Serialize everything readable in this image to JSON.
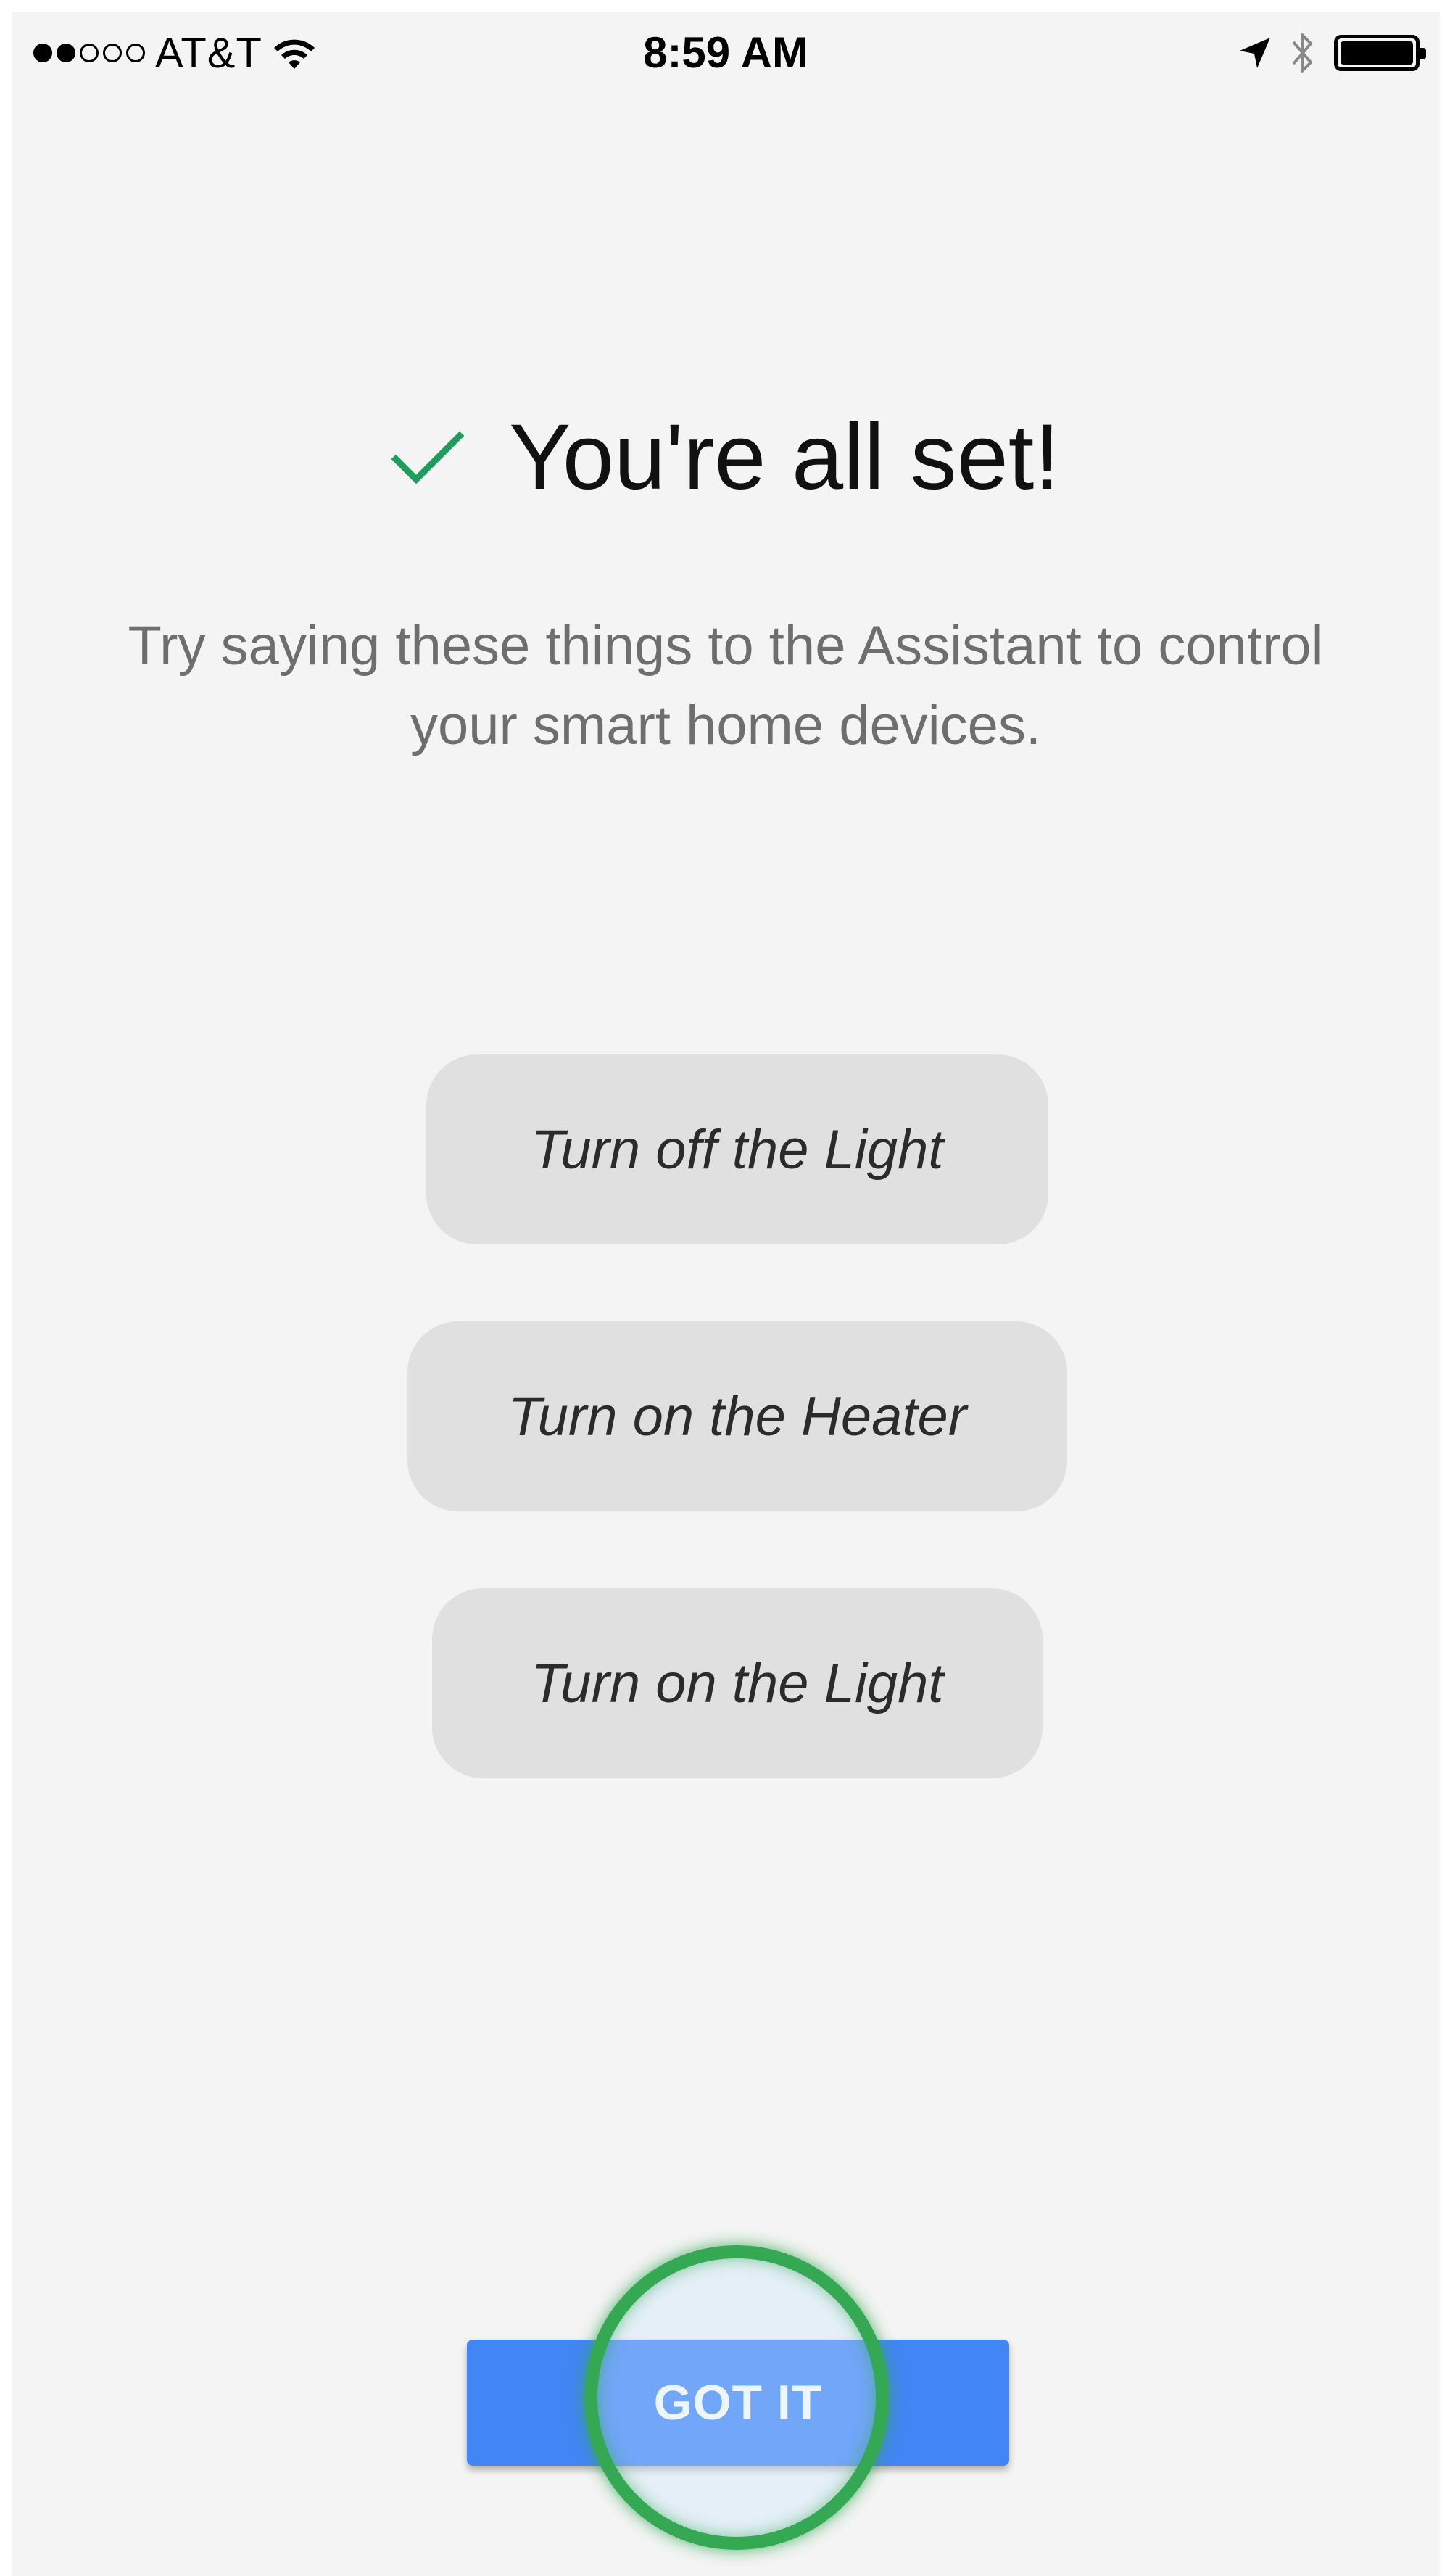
{
  "status_bar": {
    "carrier": "AT&T",
    "time": "8:59 AM",
    "signal_bars_filled": 2,
    "signal_bars_total": 5,
    "battery_level": 1.0,
    "icons": [
      "wifi-icon",
      "location-arrow-icon",
      "bluetooth-icon",
      "battery-icon"
    ]
  },
  "main": {
    "title": "You're all set!",
    "subtitle": "Try saying these things to the Assistant to control your smart home devices.",
    "suggestions": [
      "Turn off the Light",
      "Turn on the Heater",
      "Turn on the Light"
    ],
    "got_it_label": "GOT IT"
  },
  "colors": {
    "background": "#f4f4f4",
    "check": "#1e9e5a",
    "button": "#4285f4",
    "chip": "#e0e0e0",
    "tap_ring": "#34a853"
  }
}
